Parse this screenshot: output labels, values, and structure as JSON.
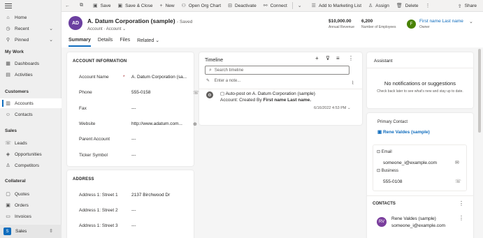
{
  "sidebar": {
    "home": "Home",
    "recent": "Recent",
    "pinned": "Pinned",
    "my_work_heading": "My Work",
    "dashboards": "Dashboards",
    "activities": "Activities",
    "customers_heading": "Customers",
    "accounts": "Accounts",
    "contacts": "Contacts",
    "sales_heading": "Sales",
    "leads": "Leads",
    "opportunities": "Opportunities",
    "competitors": "Competitors",
    "collateral_heading": "Collateral",
    "quotes": "Quotes",
    "orders": "Orders",
    "invoices": "Invoices",
    "area_badge": "S",
    "area_name": "Sales"
  },
  "commands": {
    "save": "Save",
    "save_close": "Save & Close",
    "new": "New",
    "open_org_chart": "Open Org Chart",
    "deactivate": "Deactivate",
    "connect": "Connect",
    "add_marketing": "Add to Marketing List",
    "assign": "Assign",
    "delete": "Delete",
    "share": "Share"
  },
  "header": {
    "avatar_initials": "AD",
    "title": "A. Datum Corporation (sample)",
    "saved": "- Saved",
    "entity": "Account",
    "form": "Account",
    "annual_revenue_value": "$10,000.00",
    "annual_revenue_label": "Annual Revenue",
    "employees_value": "6,200",
    "employees_label": "Number of Employees",
    "owner_initial": "F",
    "owner_name": "First name Last name",
    "owner_label": "Owner"
  },
  "tabs": [
    "Summary",
    "Details",
    "Files",
    "Related"
  ],
  "account_info": {
    "title": "ACCOUNT INFORMATION",
    "fields": [
      {
        "label": "Account Name",
        "value": "A. Datum Corporation (sa..."
      },
      {
        "label": "Phone",
        "value": "555-0158"
      },
      {
        "label": "Fax",
        "value": "---"
      },
      {
        "label": "Website",
        "value": "http://www.adatum.com..."
      },
      {
        "label": "Parent Account",
        "value": "---"
      },
      {
        "label": "Ticker Symbol",
        "value": "---"
      }
    ],
    "required_mark": "*"
  },
  "address": {
    "title": "ADDRESS",
    "fields": [
      {
        "label": "Address 1: Street 1",
        "value": "2137 Birchwood Dr"
      },
      {
        "label": "Address 1: Street 2",
        "value": "---"
      },
      {
        "label": "Address 1: Street 3",
        "value": "---"
      }
    ]
  },
  "timeline": {
    "title": "Timeline",
    "search_placeholder": "Search timeline",
    "note_placeholder": "Enter a note...",
    "post_title": "Auto-post on A. Datum Corporation (sample)",
    "post_body_prefix": "Account: Created By",
    "post_author": "First name Last name.",
    "post_time": "6/16/2022 4:53 PM"
  },
  "assistant": {
    "title": "Assistant",
    "empty_title": "No notifications or suggestions",
    "empty_body": "Check back later to see what's new and stay up to date."
  },
  "primary_contact": {
    "label": "Primary Contact",
    "name": "Rene Valdes (sample)",
    "email_label": "Email",
    "email": "someone_i@example.com",
    "business_label": "Business",
    "business_phone": "555-0108"
  },
  "contacts": {
    "title": "CONTACTS",
    "initials": "RV",
    "name": "Rene Valdes (sample)",
    "email": "someone_i@example.com"
  }
}
